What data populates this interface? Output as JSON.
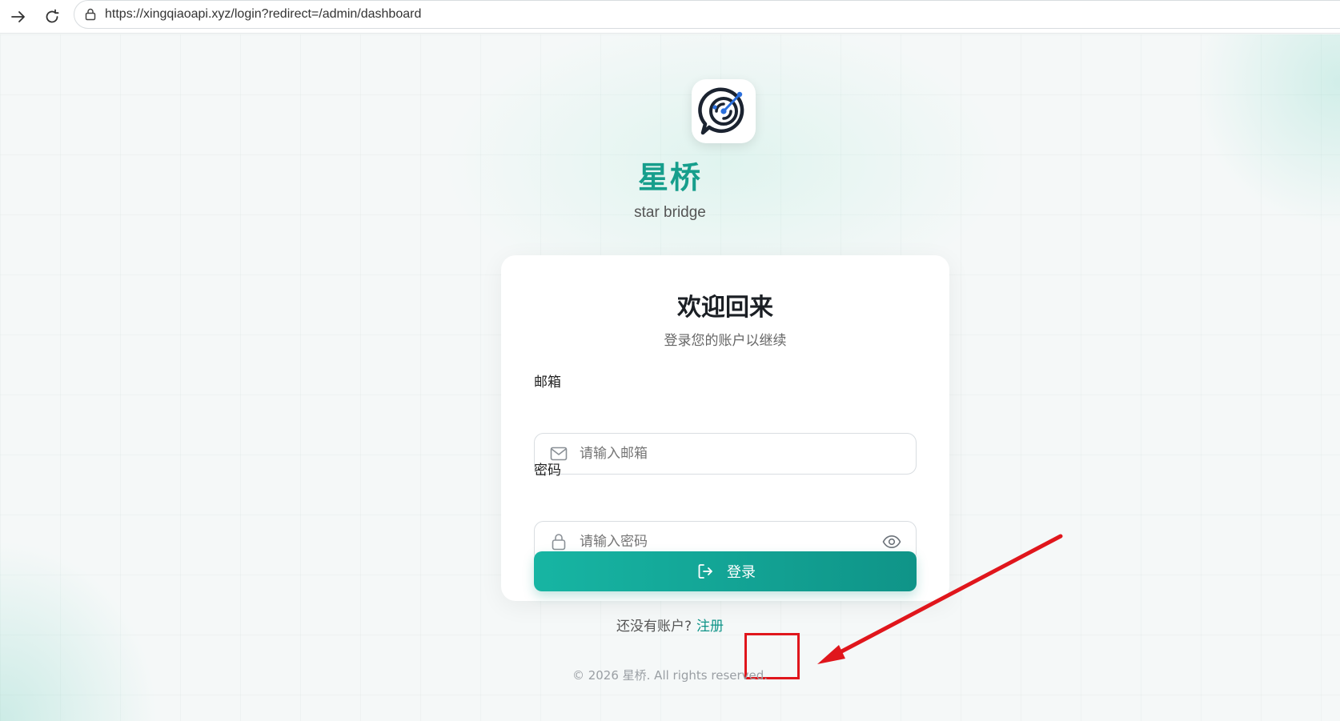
{
  "browser": {
    "url": "https://xingqiaoapi.xyz/login?redirect=/admin/dashboard",
    "icons": [
      "forward-icon",
      "reload-icon",
      "lock-icon"
    ]
  },
  "brand": {
    "name": "星桥",
    "subtitle": "star bridge",
    "logo_icon": "radar-chat-icon"
  },
  "login_card": {
    "title": "欢迎回来",
    "subtitle": "登录您的账户以继续",
    "email_label": "邮箱",
    "email_placeholder": "请输入邮箱",
    "password_label": "密码",
    "password_placeholder": "请输入密码",
    "submit_label": "登录"
  },
  "signup": {
    "prompt": "还没有账户?",
    "link_label": "注册"
  },
  "footer": {
    "copyright": "© 2026 星桥. All rights reserved."
  },
  "colors": {
    "accent": "#169e8c",
    "button_start": "#17b5a3",
    "button_end": "#0f9488",
    "annotation_red": "#e0161c"
  }
}
